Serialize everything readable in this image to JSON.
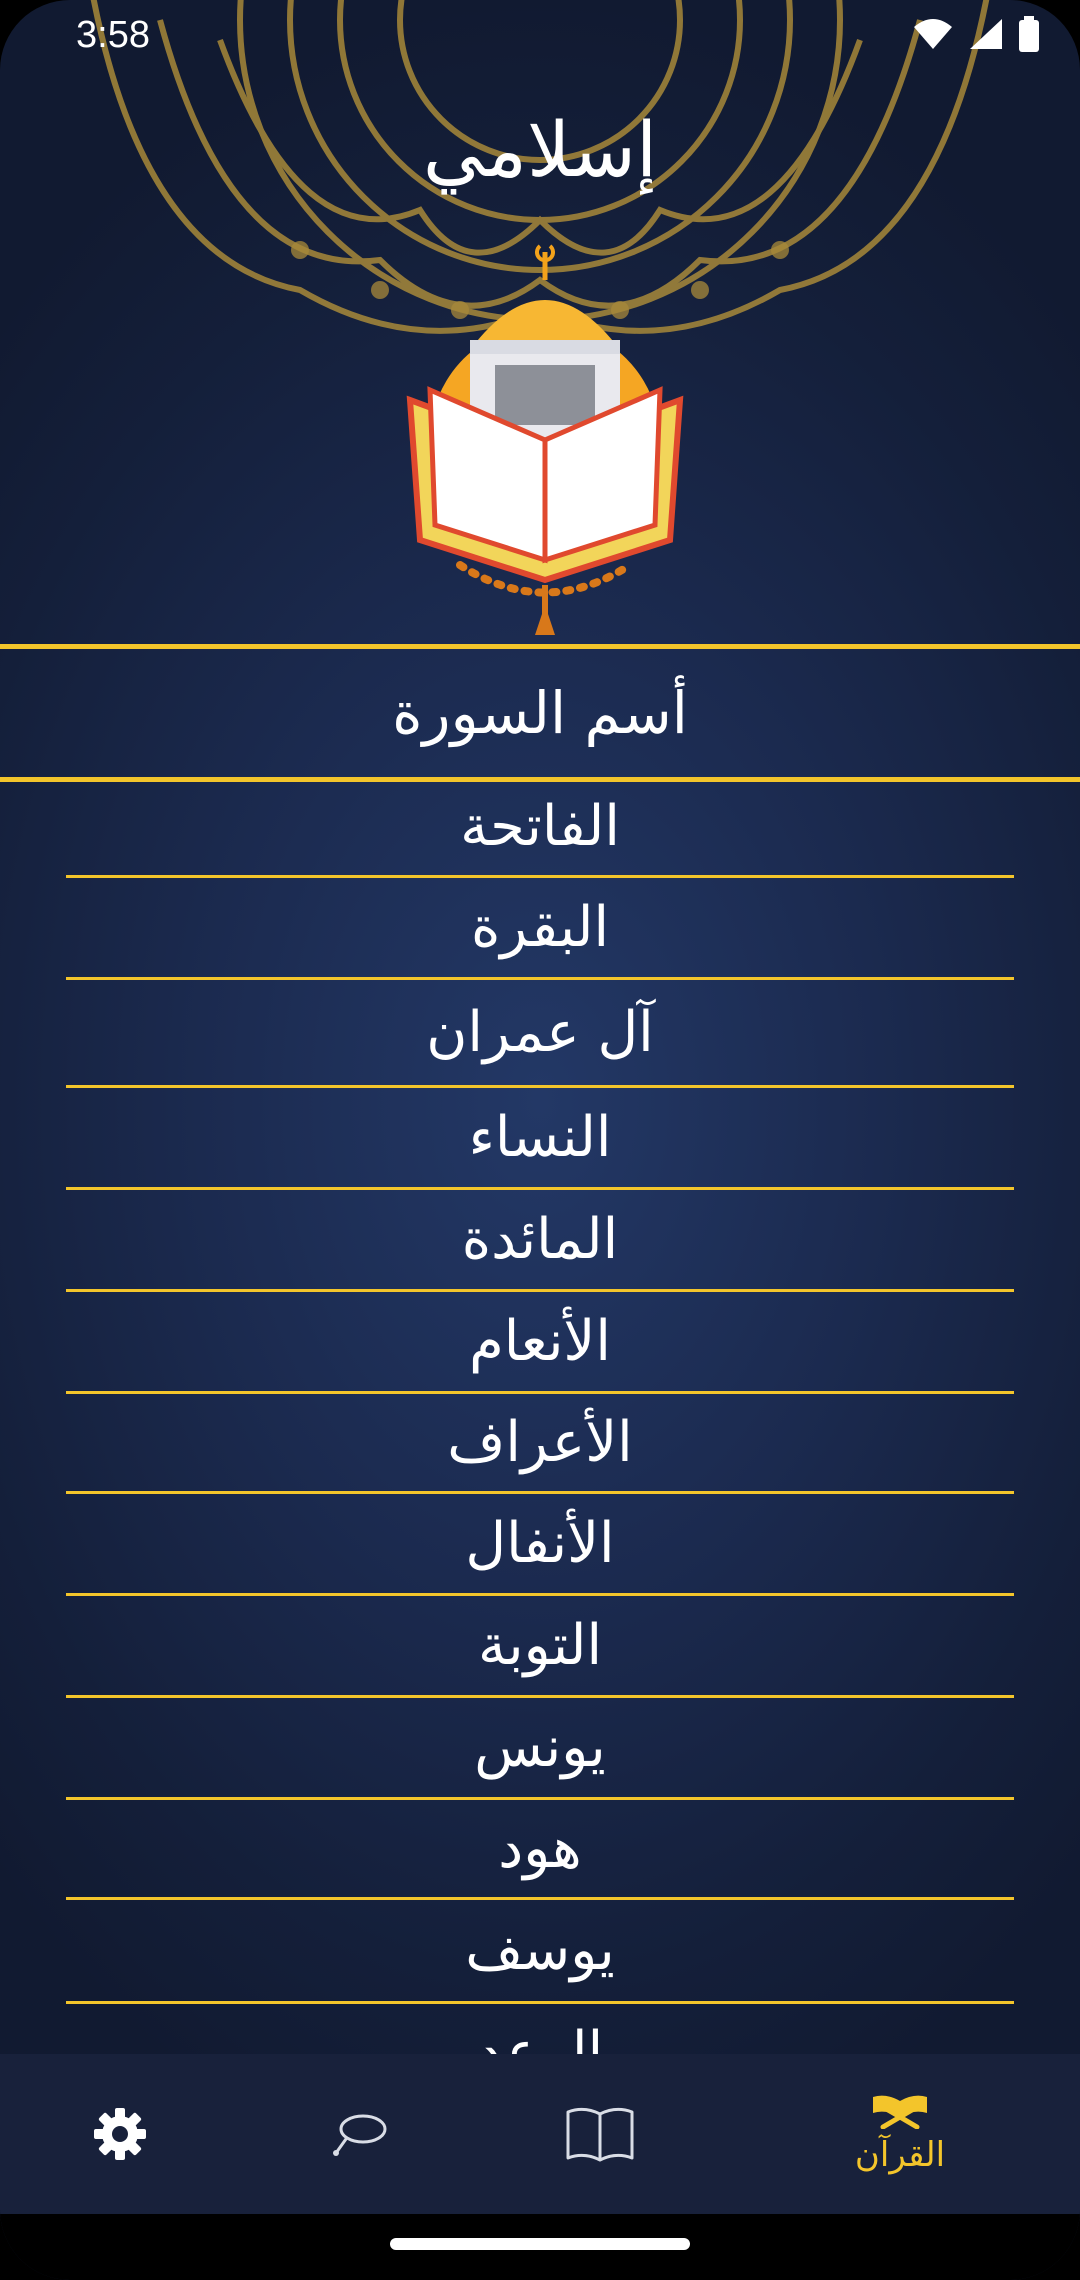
{
  "status_bar": {
    "time": "3:58"
  },
  "app": {
    "title": "إسلامي"
  },
  "table": {
    "header": "أسم السورة",
    "surahs": [
      "الفاتحة",
      "البقرة",
      "آل عمران",
      "النساء",
      "المائدة",
      "الأنعام",
      "الأعراف",
      "الأنفال",
      "التوبة",
      "يونس",
      "هود",
      "يوسف",
      "الرعد"
    ]
  },
  "bottom_nav": {
    "items": [
      {
        "icon": "gear-icon",
        "label": ""
      },
      {
        "icon": "prayer-beads-icon",
        "label": ""
      },
      {
        "icon": "book-icon",
        "label": ""
      },
      {
        "icon": "quran-icon",
        "label": "القرآن",
        "active": true
      }
    ]
  },
  "colors": {
    "accent": "#f3c52b",
    "background": "#1b2a4f",
    "nav": "#18213b"
  }
}
